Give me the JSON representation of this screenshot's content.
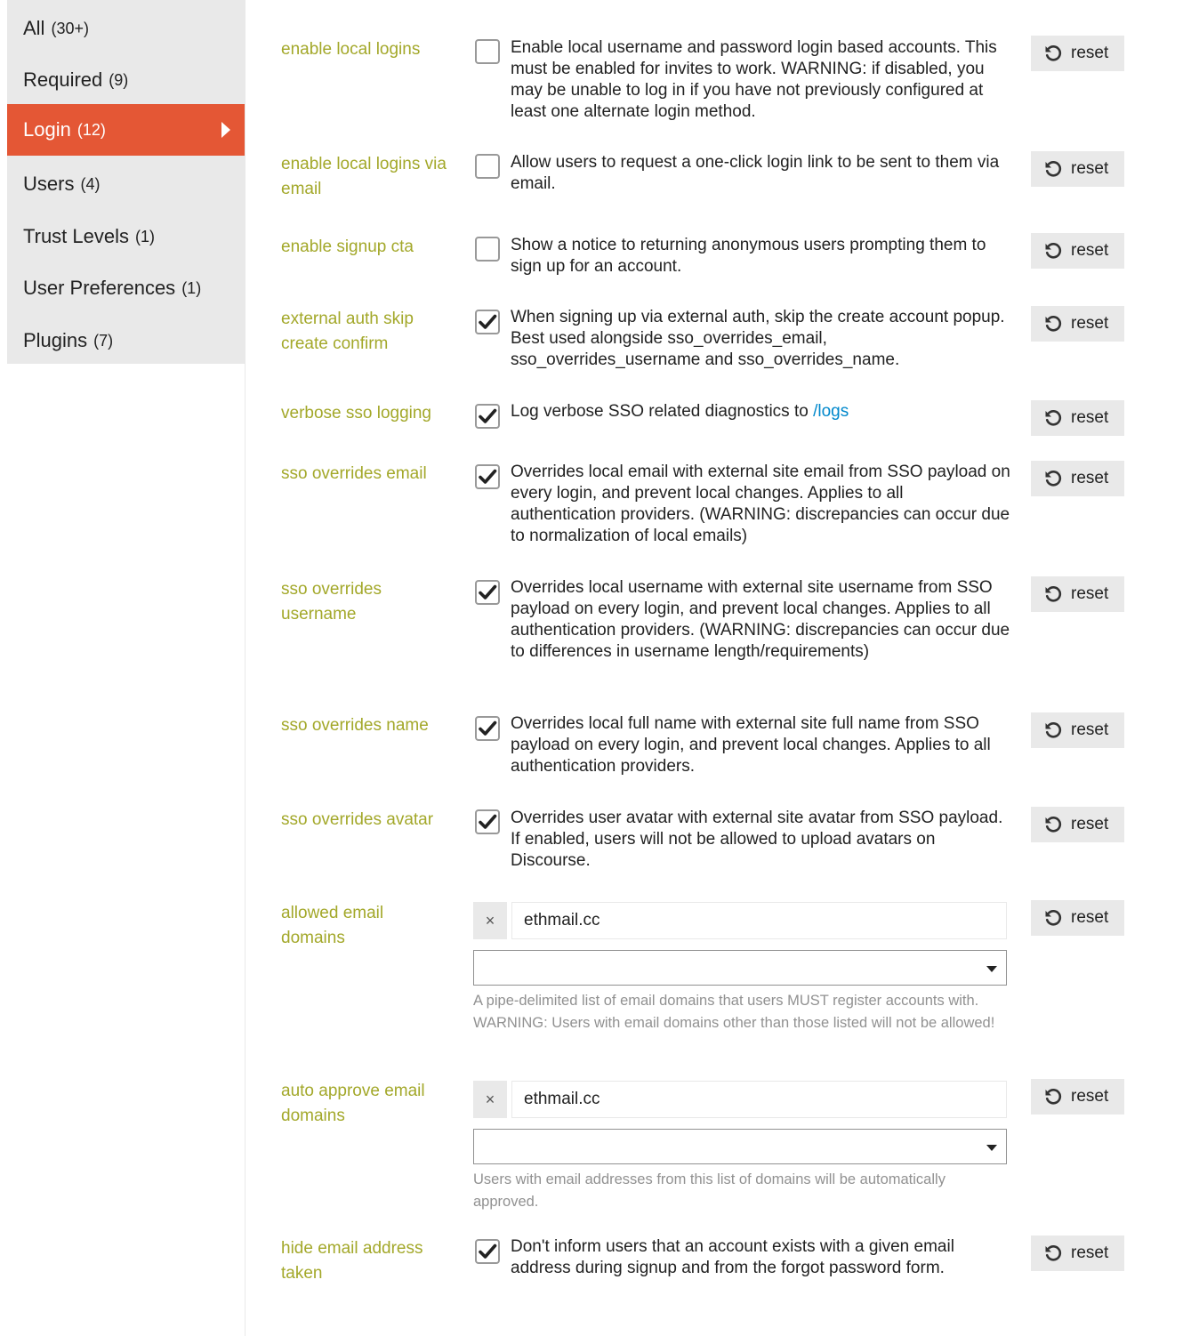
{
  "sidebar": {
    "items": [
      {
        "label": "All",
        "count": "(30+)"
      },
      {
        "label": "Required",
        "count": "(9)"
      },
      {
        "label": "Login",
        "count": "(12)"
      },
      {
        "label": "Users",
        "count": "(4)"
      },
      {
        "label": "Trust Levels",
        "count": "(1)"
      },
      {
        "label": "User Preferences",
        "count": "(1)"
      },
      {
        "label": "Plugins",
        "count": "(7)"
      }
    ],
    "active_item": "Login"
  },
  "reset_label": "reset",
  "settings": [
    {
      "label": "enable local logins",
      "checked": false,
      "description": "Enable local username and password login based accounts. This must be enabled for invites to work. WARNING: if disabled, you may be unable to log in if you have not previously configured at least one alternate login method."
    },
    {
      "label": "enable local logins via email",
      "checked": false,
      "description": "Allow users to request a one-click login link to be sent to them via email."
    },
    {
      "label": "enable signup cta",
      "checked": false,
      "description": "Show a notice to returning anonymous users prompting them to sign up for an account."
    },
    {
      "label": "external auth skip create confirm",
      "checked": true,
      "description": "When signing up via external auth, skip the create account popup. Best used alongside sso_overrides_email, sso_overrides_username and sso_overrides_name."
    },
    {
      "label": "verbose sso logging",
      "checked": true,
      "description": "Log verbose SSO related diagnostics to",
      "link": "/logs"
    },
    {
      "label": "sso overrides email",
      "checked": true,
      "description": "Overrides local email with external site email from SSO payload on every login, and prevent local changes. Applies to all authentication providers. (WARNING: discrepancies can occur due to normalization of local emails)"
    },
    {
      "label": "sso overrides username",
      "checked": true,
      "description": "Overrides local username with external site username from SSO payload on every login, and prevent local changes. Applies to all authentication providers. (WARNING: discrepancies can occur due to differences in username length/requirements)"
    },
    {
      "label": "sso overrides name",
      "checked": true,
      "description": "Overrides local full name with external site full name from SSO payload on every login, and prevent local changes. Applies to all authentication providers."
    },
    {
      "label": "sso overrides avatar",
      "checked": true,
      "description": "Overrides user avatar with external site avatar from SSO payload. If enabled, users will not be allowed to upload avatars on Discourse."
    },
    {
      "label": "allowed email domains",
      "chip_remove": "×",
      "value": "ethmail.cc",
      "help": "A pipe-delimited list of email domains that users MUST register accounts with. WARNING: Users with email domains other than those listed will not be allowed!"
    },
    {
      "label": "auto approve email domains",
      "chip_remove": "×",
      "value": "ethmail.cc",
      "help": "Users with email addresses from this list of domains will be automatically approved."
    },
    {
      "label": "hide email address taken",
      "checked": true,
      "description": "Don't inform users that an account exists with a given email address during signup and from the forgot password form."
    }
  ],
  "colors": {
    "accent": "#e45735",
    "setting_label": "#a3a82a",
    "link": "#0088cc",
    "muted": "#919191",
    "panel": "#e9e9e9"
  },
  "icons": {
    "reset": "undo-icon",
    "checked": "check-icon",
    "active_nav": "caret-right-icon",
    "remove_chip": "times-icon",
    "dropdown": "caret-down-icon"
  }
}
